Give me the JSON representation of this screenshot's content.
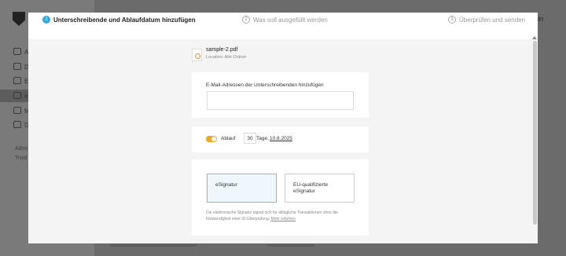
{
  "steps": [
    {
      "num": "1",
      "label": "Unterschreibende und Ablaufdatum hinzufügen",
      "state": "active"
    },
    {
      "num": "2",
      "label": "Was soll ausgefüllt werden",
      "state": "inactive"
    },
    {
      "num": "3",
      "label": "Überprüfen und senden",
      "state": "inactive"
    }
  ],
  "background": {
    "nav_letters": [
      "A",
      "D",
      "E",
      "e",
      "M",
      "D"
    ],
    "section_texts": [
      "Admi",
      "Trust"
    ],
    "right_text": "in"
  },
  "file": {
    "name": "sample-2.pdf",
    "location": "Location: Alle Ordner"
  },
  "recipients": {
    "label": "E-Mail-Adressen der Unterschreibenden hinzufügen",
    "value": "",
    "placeholder": ""
  },
  "expiration": {
    "enabled": true,
    "label": "Ablauf",
    "days": "30",
    "days_unit": "Tage,",
    "date": "10.8.2025"
  },
  "signature": {
    "options": [
      "eSignatur",
      "EU-qualifizierte eSignatur"
    ],
    "selected": "eSignatur",
    "description": "Die elektronische Signatur eignet sich für alltägliche Transaktionen ohne die Notwendigkeit einer ID-Überprüfung.",
    "learn_more": "Mehr erfahren"
  },
  "colors": {
    "accent": "#f0a820",
    "step_active": "#33a8d9"
  }
}
